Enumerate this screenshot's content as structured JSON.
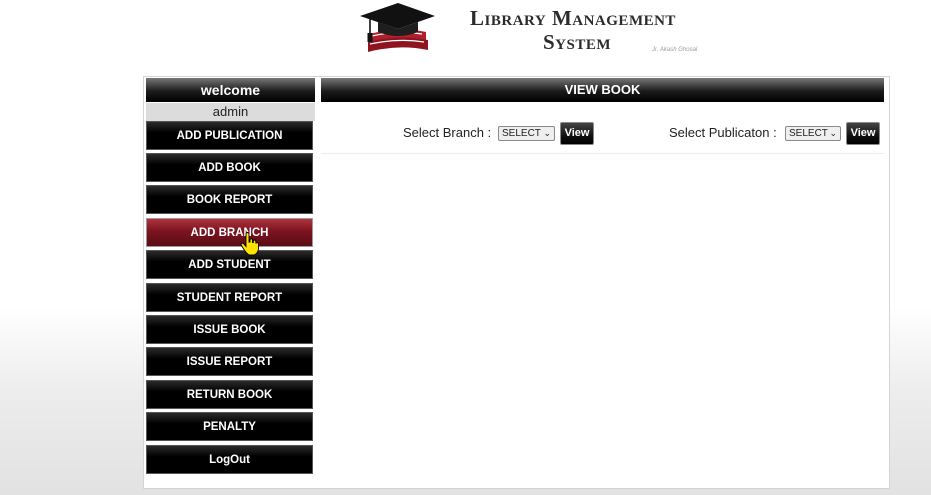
{
  "header": {
    "title_line1": "Library Management",
    "title_line2": "System",
    "byline": "Jr. Akash Ghosal"
  },
  "sidebar": {
    "welcome": "welcome",
    "user": "admin",
    "items": [
      {
        "label": "ADD PUBLICATION"
      },
      {
        "label": "ADD BOOK"
      },
      {
        "label": "BOOK REPORT"
      },
      {
        "label": "ADD BRANCH",
        "active": true
      },
      {
        "label": "ADD STUDENT"
      },
      {
        "label": "STUDENT REPORT"
      },
      {
        "label": "ISSUE BOOK"
      },
      {
        "label": "ISSUE REPORT"
      },
      {
        "label": "RETURN BOOK"
      },
      {
        "label": "PENALTY"
      },
      {
        "label": "LogOut"
      }
    ]
  },
  "main": {
    "title": "VIEW BOOK",
    "branch_label": "Select Branch :",
    "branch_selected": "SELECT",
    "publication_label": "Select Publicaton :",
    "publication_selected": "SELECT",
    "view_label": "View"
  },
  "colors": {
    "active_item": "#7b1420",
    "menu_bg": "#000000",
    "logo_red": "#b0202c"
  }
}
